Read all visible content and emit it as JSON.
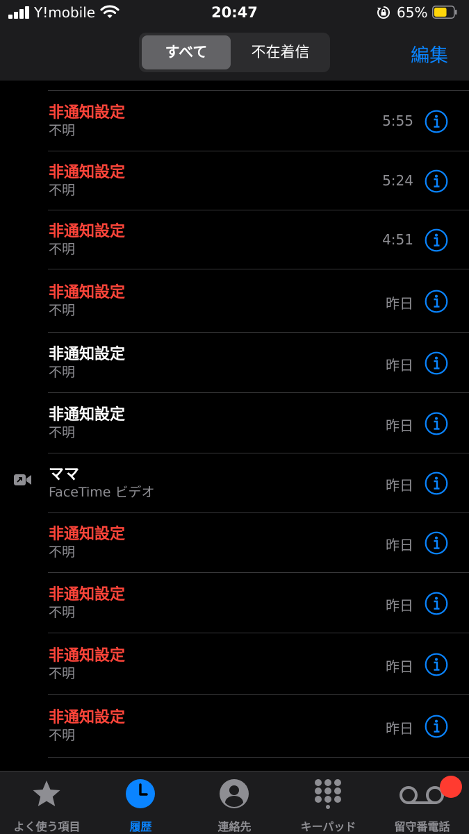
{
  "status_bar": {
    "carrier": "Y!mobile",
    "time": "20:47",
    "battery_percent": "65%",
    "battery_level": 0.65,
    "battery_color": "#ffd60a"
  },
  "header": {
    "segments": [
      {
        "label": "すべて",
        "selected": true
      },
      {
        "label": "不在着信",
        "selected": false
      }
    ],
    "edit_label": "編集",
    "accent": "#0a84ff"
  },
  "calls": [
    {
      "name": "非通知設定",
      "subtitle": "不明",
      "time": "5:55",
      "missed": true,
      "icon": null
    },
    {
      "name": "非通知設定",
      "subtitle": "不明",
      "time": "5:24",
      "missed": true,
      "icon": null
    },
    {
      "name": "非通知設定",
      "subtitle": "不明",
      "time": "4:51",
      "missed": true,
      "icon": null
    },
    {
      "name": "非通知設定",
      "subtitle": "不明",
      "time": "昨日",
      "missed": true,
      "icon": null
    },
    {
      "name": "非通知設定",
      "subtitle": "不明",
      "time": "昨日",
      "missed": false,
      "icon": null
    },
    {
      "name": "非通知設定",
      "subtitle": "不明",
      "time": "昨日",
      "missed": false,
      "icon": null
    },
    {
      "name": "ママ",
      "subtitle": "FaceTime ビデオ",
      "time": "昨日",
      "missed": false,
      "icon": "facetime-outgoing-icon"
    },
    {
      "name": "非通知設定",
      "subtitle": "不明",
      "time": "昨日",
      "missed": true,
      "icon": null
    },
    {
      "name": "非通知設定",
      "subtitle": "不明",
      "time": "昨日",
      "missed": true,
      "icon": null
    },
    {
      "name": "非通知設定",
      "subtitle": "不明",
      "time": "昨日",
      "missed": true,
      "icon": null
    },
    {
      "name": "非通知設定",
      "subtitle": "不明",
      "time": "昨日",
      "missed": true,
      "icon": null
    }
  ],
  "tabs": [
    {
      "label": "よく使う項目",
      "icon": "star-icon",
      "active": false
    },
    {
      "label": "履歴",
      "icon": "clock-icon",
      "active": true
    },
    {
      "label": "連絡先",
      "icon": "contact-icon",
      "active": false
    },
    {
      "label": "キーパッド",
      "icon": "keypad-icon",
      "active": false
    },
    {
      "label": "留守番電話",
      "icon": "voicemail-icon",
      "active": false,
      "badge": true
    }
  ]
}
